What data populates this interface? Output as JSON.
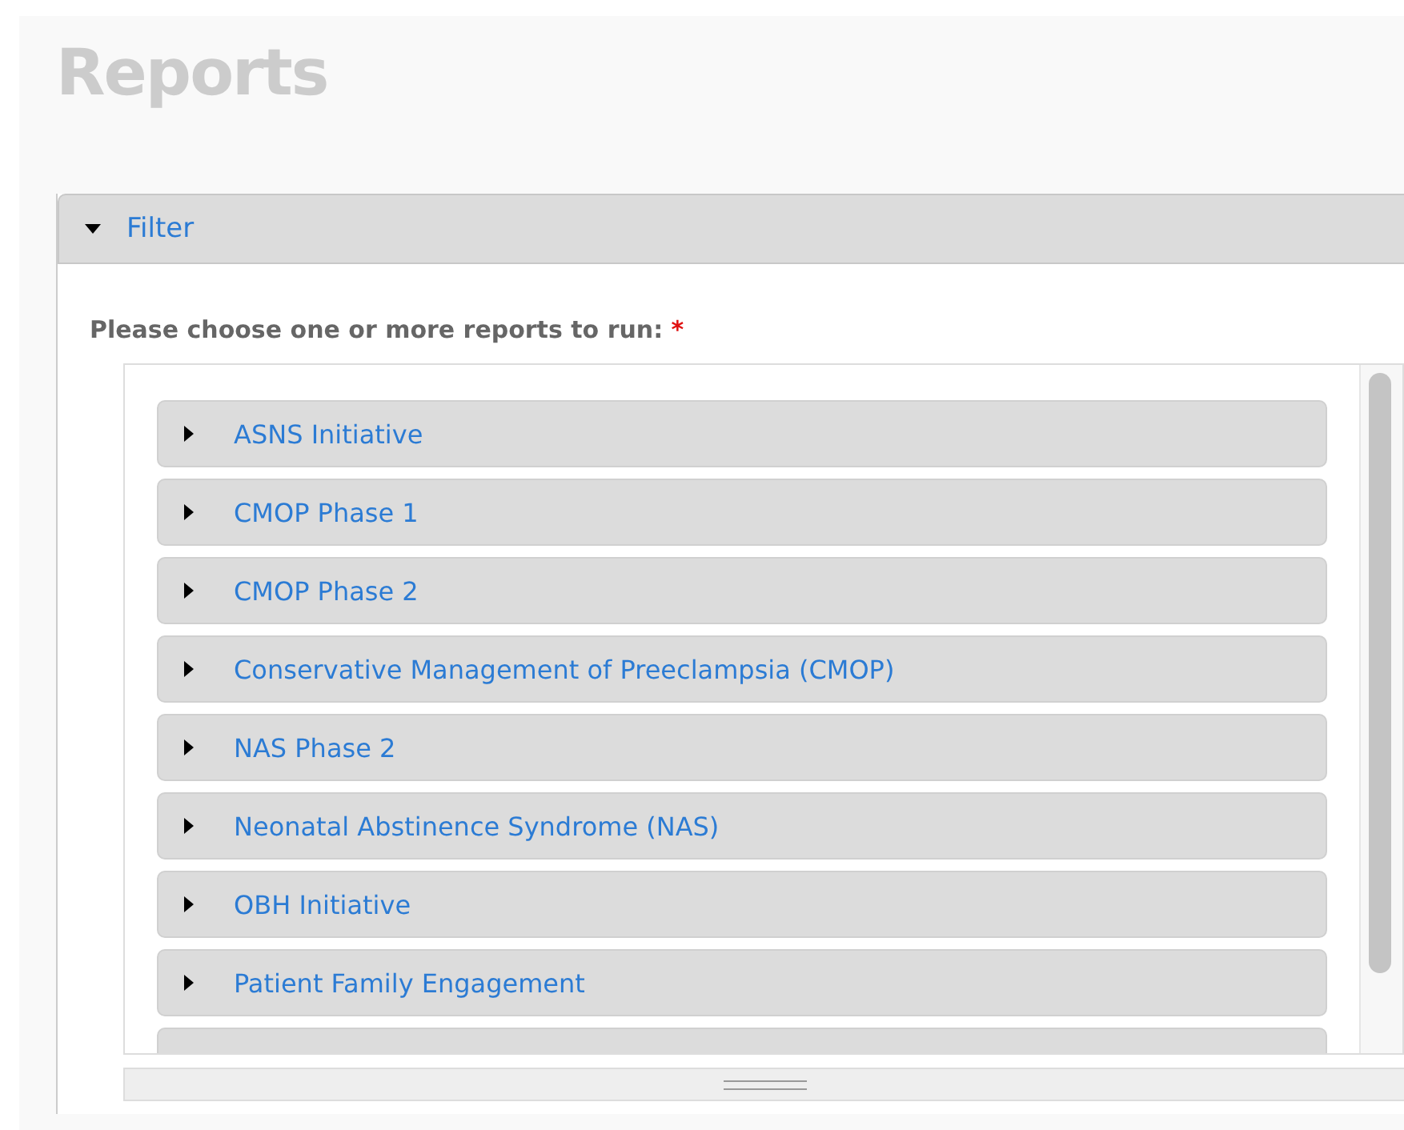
{
  "page": {
    "title": "Reports"
  },
  "filter": {
    "title": "Filter",
    "expanded": true,
    "prompt": "Please choose one or more reports to run:",
    "required_mark": "*",
    "reports": [
      {
        "name": "ASNS Initiative",
        "expanded": false
      },
      {
        "name": "CMOP Phase 1",
        "expanded": false
      },
      {
        "name": "CMOP Phase 2",
        "expanded": false
      },
      {
        "name": "Conservative Management of Preeclampsia (CMOP)",
        "expanded": false
      },
      {
        "name": "NAS Phase 2",
        "expanded": false
      },
      {
        "name": "Neonatal Abstinence Syndrome (NAS)",
        "expanded": false
      },
      {
        "name": "OBH Initiative",
        "expanded": false
      },
      {
        "name": "Patient Family Engagement",
        "expanded": false
      }
    ]
  }
}
